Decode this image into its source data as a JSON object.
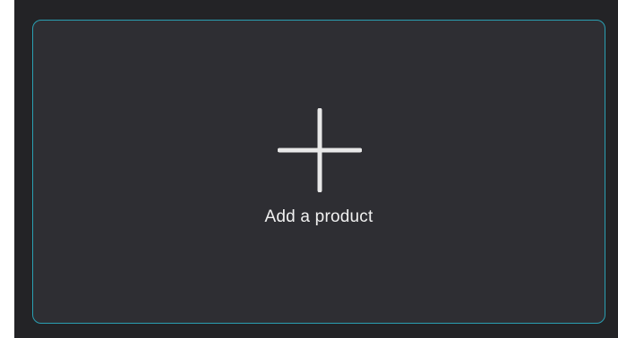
{
  "add_product_card": {
    "label": "Add a product",
    "icon": "plus-icon"
  },
  "colors": {
    "background": "#232326",
    "card_background": "#2e2e33",
    "accent_border": "#2a9fb2",
    "text": "#f1f1f1",
    "icon": "#e8e8e8"
  }
}
